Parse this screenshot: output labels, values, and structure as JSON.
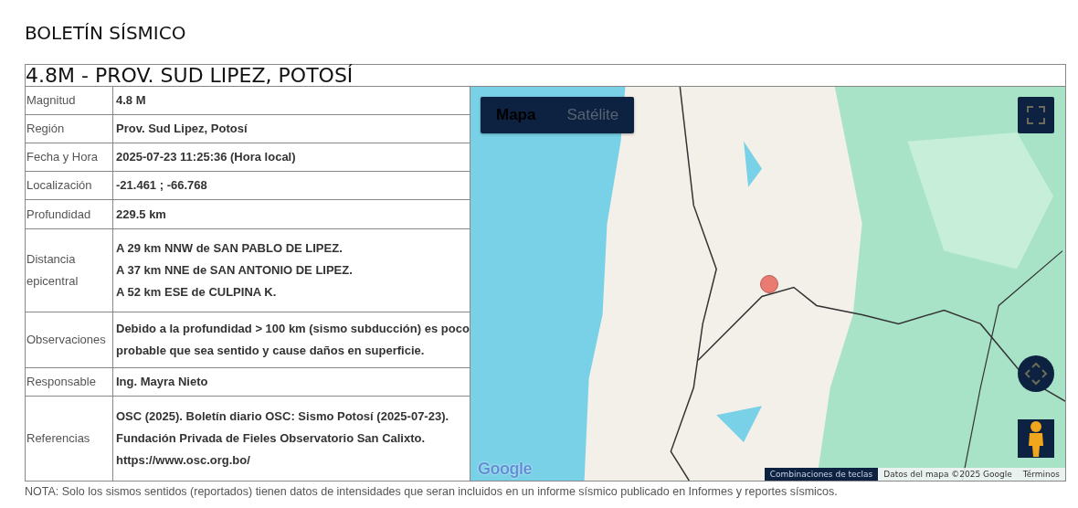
{
  "page_title": "BOLETÍN SÍSMICO",
  "report": {
    "title": "4.8M - PROV. SUD LIPEZ, POTOSÍ",
    "rows": [
      {
        "label": "Magnitud",
        "lines": [
          "4.8 M"
        ]
      },
      {
        "label": "Región",
        "lines": [
          "Prov. Sud Lipez, Potosí"
        ]
      },
      {
        "label": "Fecha y Hora",
        "lines": [
          "2025-07-23 11:25:36 (Hora local)"
        ]
      },
      {
        "label": "Localización",
        "lines": [
          "-21.461 ; -66.768"
        ]
      },
      {
        "label": "Profundidad",
        "lines": [
          "229.5 km"
        ]
      },
      {
        "label": "Distancia epicentral",
        "lines": [
          "A 29 km NNW de SAN PABLO DE LIPEZ.",
          "A 37 km NNE de SAN ANTONIO DE LIPEZ.",
          "A 52 km ESE de CULPINA K."
        ]
      },
      {
        "label": "Observaciones",
        "lines": [
          "Debido a la profundidad > 100 km (sismo subducción) es poco probable que sea sentido y cause daños en superficie."
        ]
      },
      {
        "label": "Responsable",
        "lines": [
          "Ing. Mayra Nieto"
        ]
      },
      {
        "label": "Referencias",
        "lines": [
          "OSC (2025). Boletín diario OSC: Sismo Potosí (2025-07-23). Fundación Privada de Fieles Observatorio San Calixto.",
          "https://www.osc.org.bo/"
        ]
      }
    ],
    "map": {
      "map_types": [
        {
          "label": "Mapa",
          "selected": true
        },
        {
          "label": "Satélite",
          "selected": false
        }
      ],
      "logo": "Google",
      "attribution": [
        "Combinaciones de teclas",
        "Datos del mapa ©2025 Google",
        "Términos"
      ]
    }
  },
  "note": "NOTA: Solo los sismos sentidos (reportados) tienen datos de intensidades que seran incluidos en un informe sísmico publicado en Informes y reportes sísmicos."
}
